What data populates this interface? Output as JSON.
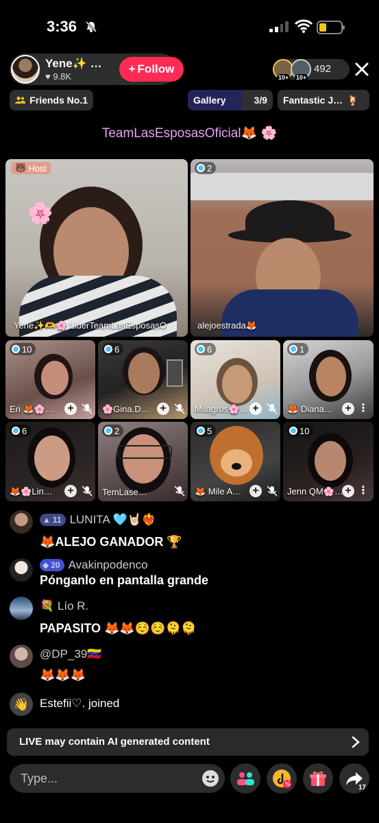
{
  "status": {
    "time": "3:36"
  },
  "host": {
    "name": "Yene✨ …",
    "likes": "9.8K",
    "follow_label": "Follow"
  },
  "viewers": {
    "count": "492",
    "avatar_badges": [
      "10+",
      "10+"
    ]
  },
  "chips": {
    "friends": "Friends No.1",
    "gallery": "Gallery",
    "gallery_count": "3/9",
    "fantastic": "Fantastic J…"
  },
  "team_banner": "TeamLasEsposasOficial🦊 🌸",
  "tiles": {
    "host_badge": "Host",
    "main": [
      {
        "name": "Yene✨🫶🌸 LiderTeamLasEsposasO",
        "badge": ""
      },
      {
        "name": "alejoestrada🦊",
        "badge": "2"
      }
    ],
    "grid": [
      {
        "name": "Eri 🦊🌸…",
        "badge": "10"
      },
      {
        "name": "🌸Gina.D…",
        "badge": "6"
      },
      {
        "name": "Milagros🌸…",
        "badge": "6"
      },
      {
        "name": "🦊 Diana…",
        "badge": "1"
      },
      {
        "name": "🦊🌸Lin…",
        "badge": "6"
      },
      {
        "name": "TemLase…",
        "badge": "2"
      },
      {
        "name": "🦊 Mile A…",
        "badge": "5"
      },
      {
        "name": "Jenn QM🌸…",
        "badge": "10"
      }
    ]
  },
  "chat": [
    {
      "user": "LUNITA 🩵🤘🏻❤️‍🔥",
      "level": "11",
      "message": "🦊ALEJO GANADOR 🏆"
    },
    {
      "user": "Avakinpodenco",
      "level": "20",
      "message": "Pónganlo en pantalla grande"
    },
    {
      "user": "💐 Lío R.",
      "level": "",
      "message": "PAPASITO 🦊🦊☺️☺️🫠🫠"
    },
    {
      "user": "@DP_39🇻🇪",
      "level": "",
      "message": "🦊🦊🦊"
    }
  ],
  "joined": "Estefii♡. joined",
  "ai_notice": "LIVE may contain AI generated content",
  "input": {
    "placeholder": "Type..."
  },
  "share_count": "17",
  "colors": {
    "follow": "#fe2c55",
    "team_banner": "#e6a3f0",
    "accent_blue": "#4fc3f7"
  }
}
